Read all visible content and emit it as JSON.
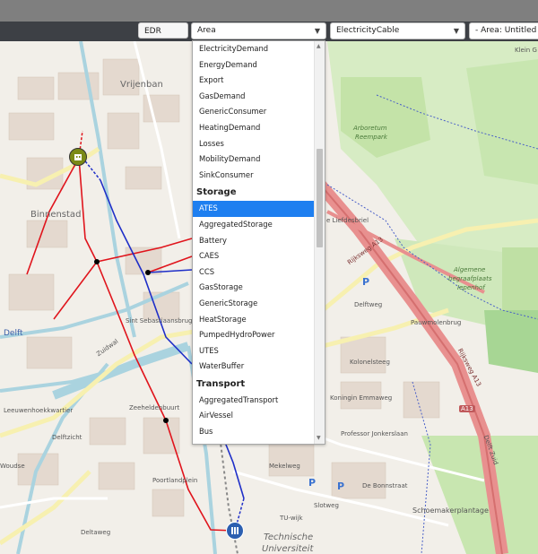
{
  "toolbar": {
    "edr_label": "EDR assets",
    "area_select": "Area",
    "cable_select": "ElectricityCable",
    "area_name_select": "- Area: Untitled Ar"
  },
  "dropdown": {
    "items_top": [
      "ElectricityDemand",
      "EnergyDemand",
      "Export",
      "GasDemand",
      "GenericConsumer",
      "HeatingDemand",
      "Losses",
      "MobilityDemand",
      "SinkConsumer"
    ],
    "group_storage": "Storage",
    "storage_items": [
      "ATES",
      "AggregatedStorage",
      "Battery",
      "CAES",
      "CCS",
      "GasStorage",
      "GenericStorage",
      "HeatStorage",
      "PumpedHydroPower",
      "UTES",
      "WaterBuffer"
    ],
    "selected": "ATES",
    "group_transport": "Transport",
    "transport_items": [
      "AggregatedTransport",
      "AirVessel",
      "Bus"
    ]
  },
  "map_labels": {
    "vrijenban": "Vrijenban",
    "binnenstad": "Binnenstad",
    "delft": "Delft",
    "leeuwenhoekkwartier": "Leeuwenhoekkwartier",
    "delftzicht": "Delftzicht",
    "zeeheldenbuurt": "Zeeheldenbuurt",
    "woudse": "Woudse",
    "technische": "Technische",
    "universiteit": "Universiteit",
    "tu_wijk": "TU-wijk",
    "arboretum": "Arboretum",
    "reempark": "Reempark",
    "algemene": "Algemene",
    "begraafplaats": "begraafplaats",
    "iepenhof": "Iepenhof",
    "pauwmolenbrug": "Pauwmolenbrug",
    "rijksweg": "Rijksweg A13",
    "rijksweg2": "Rijksweg A13",
    "a13": "A13",
    "delft_zuid": "Delft Zuid",
    "schoemakerplantage": "Schoemakerplantage",
    "sint_seb": "Sint Sebastiaansbrug",
    "liefdesbriel": "e Liefdesbriel",
    "klein": "Klein G",
    "delftweg": "Delftweg",
    "deltaweg": "Deltaweg",
    "zuidwal": "Zuidwal",
    "kolonelsteeg": "Kolonelsteeg",
    "mekelweg": "Mekelweg",
    "poortlandplein": "Poortlandplein",
    "professor": "Professor Jonkerslaan",
    "de_bonnstraat": "De Bonnstraat",
    "slothweg": "Slotweg",
    "koningin": "Koningin Emmaweg"
  },
  "colors": {
    "electric_line": "#e0141c",
    "network_line": "#1f2fc8",
    "park": "#c8e6b0",
    "motorway": "#e8908f",
    "water": "#aad3df"
  },
  "icons": [
    "building-icon",
    "ates-storage-icon",
    "dropdown-caret-icon"
  ]
}
